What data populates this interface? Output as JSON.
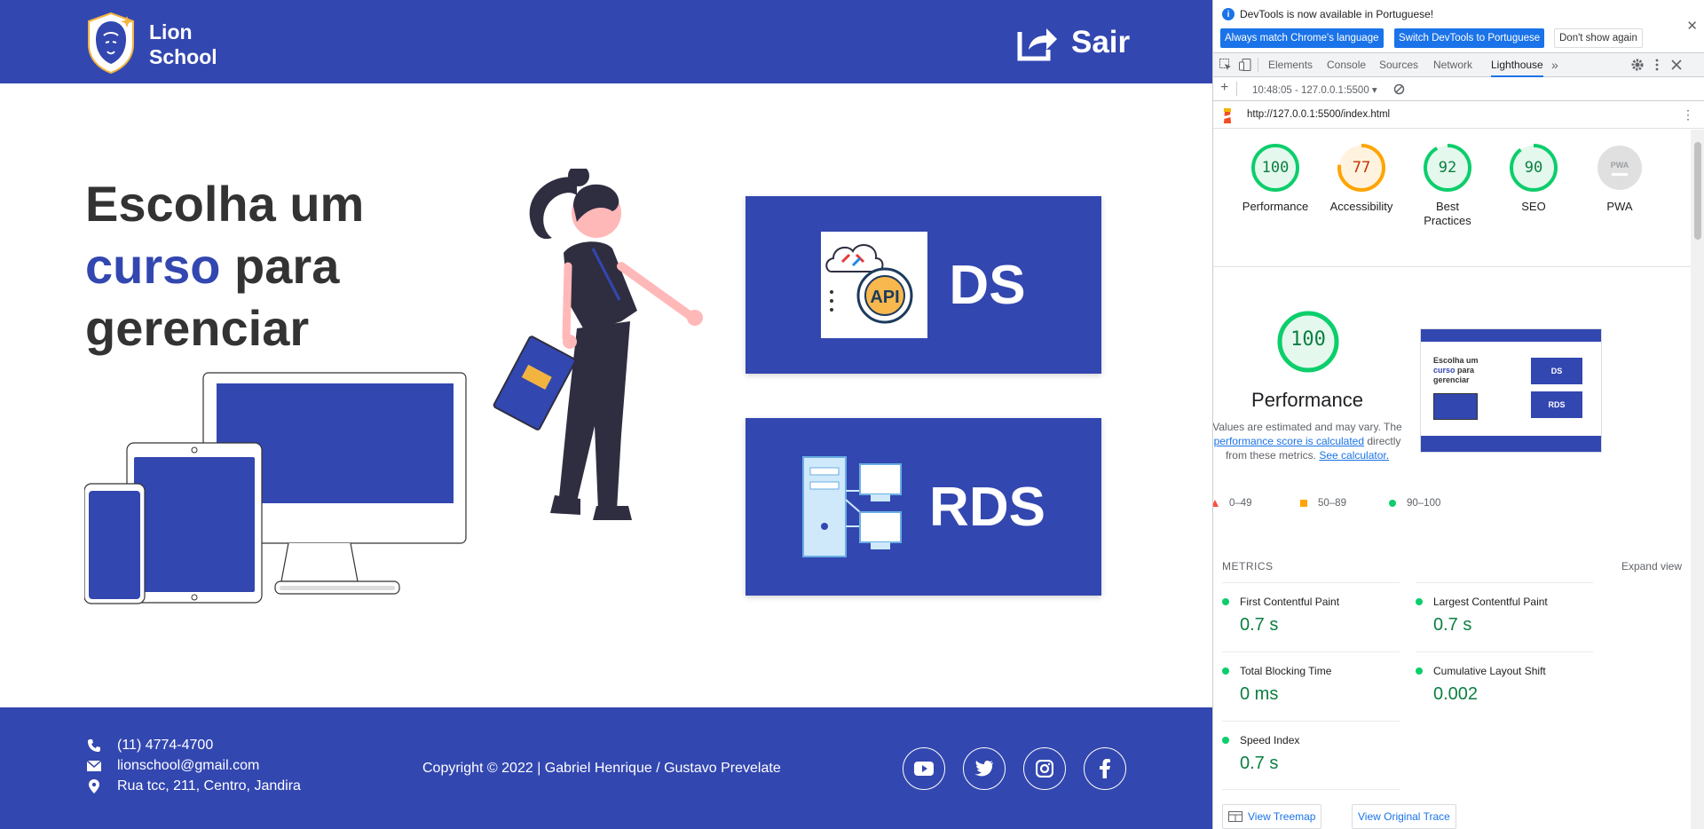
{
  "site": {
    "brand_line1": "Lion",
    "brand_line2": "School",
    "logout_label": "Sair",
    "hero_part1": "Escolha um",
    "hero_accent": "curso",
    "hero_part2": " para",
    "hero_part3": "gerenciar",
    "courses": [
      {
        "label": "DS"
      },
      {
        "label": "RDS"
      }
    ],
    "footer": {
      "phone": "(11) 4774-4700",
      "email": "lionschool@gmail.com",
      "address": "Rua tcc, 211, Centro, Jandira",
      "copyright": "Copyright © 2022 | Gabriel Henrique / Gustavo Prevelate"
    },
    "colors": {
      "primary": "#3347b0",
      "text": "#333333"
    }
  },
  "devtools": {
    "info_message": "DevTools is now available in Portuguese!",
    "btn_match": "Always match Chrome's language",
    "btn_switch": "Switch DevTools to Portuguese",
    "btn_dont_show": "Don't show again",
    "tabs": [
      "Elements",
      "Console",
      "Sources",
      "Network",
      "Lighthouse"
    ],
    "active_tab": "Lighthouse",
    "report_select": "10:48:05 - 127.0.0.1:5500",
    "report_url": "http://127.0.0.1:5500/index.html",
    "gauges": [
      {
        "score": "100",
        "label": "Performance",
        "color": "#0cce6b",
        "value": 100
      },
      {
        "score": "77",
        "label": "Accessibility",
        "color": "#ffa400",
        "value": 77
      },
      {
        "score": "92",
        "label": "Best Practices",
        "color": "#0cce6b",
        "value": 92
      },
      {
        "score": "90",
        "label": "SEO",
        "color": "#0cce6b",
        "value": 90
      },
      {
        "score": "",
        "label": "PWA",
        "color": "#dadce0",
        "value": 0
      }
    ],
    "pwa_badge": "PWA",
    "performance": {
      "score": "100",
      "title": "Performance",
      "desc_1": "Values are estimated and may vary. The",
      "desc_link": "performance score is calculated",
      "desc_2": "directly from these metrics.",
      "desc_link2": "See calculator.",
      "legend": [
        "0–49",
        "50–89",
        "90–100"
      ]
    },
    "metrics_title": "METRICS",
    "expand_label": "Expand view",
    "metrics": [
      {
        "name": "First Contentful Paint",
        "value": "0.7 s"
      },
      {
        "name": "Largest Contentful Paint",
        "value": "0.7 s"
      },
      {
        "name": "Total Blocking Time",
        "value": "0 ms"
      },
      {
        "name": "Cumulative Layout Shift",
        "value": "0.002"
      },
      {
        "name": "Speed Index",
        "value": "0.7 s"
      }
    ],
    "view_treemap": "View Treemap",
    "view_trace": "View Original Trace"
  }
}
